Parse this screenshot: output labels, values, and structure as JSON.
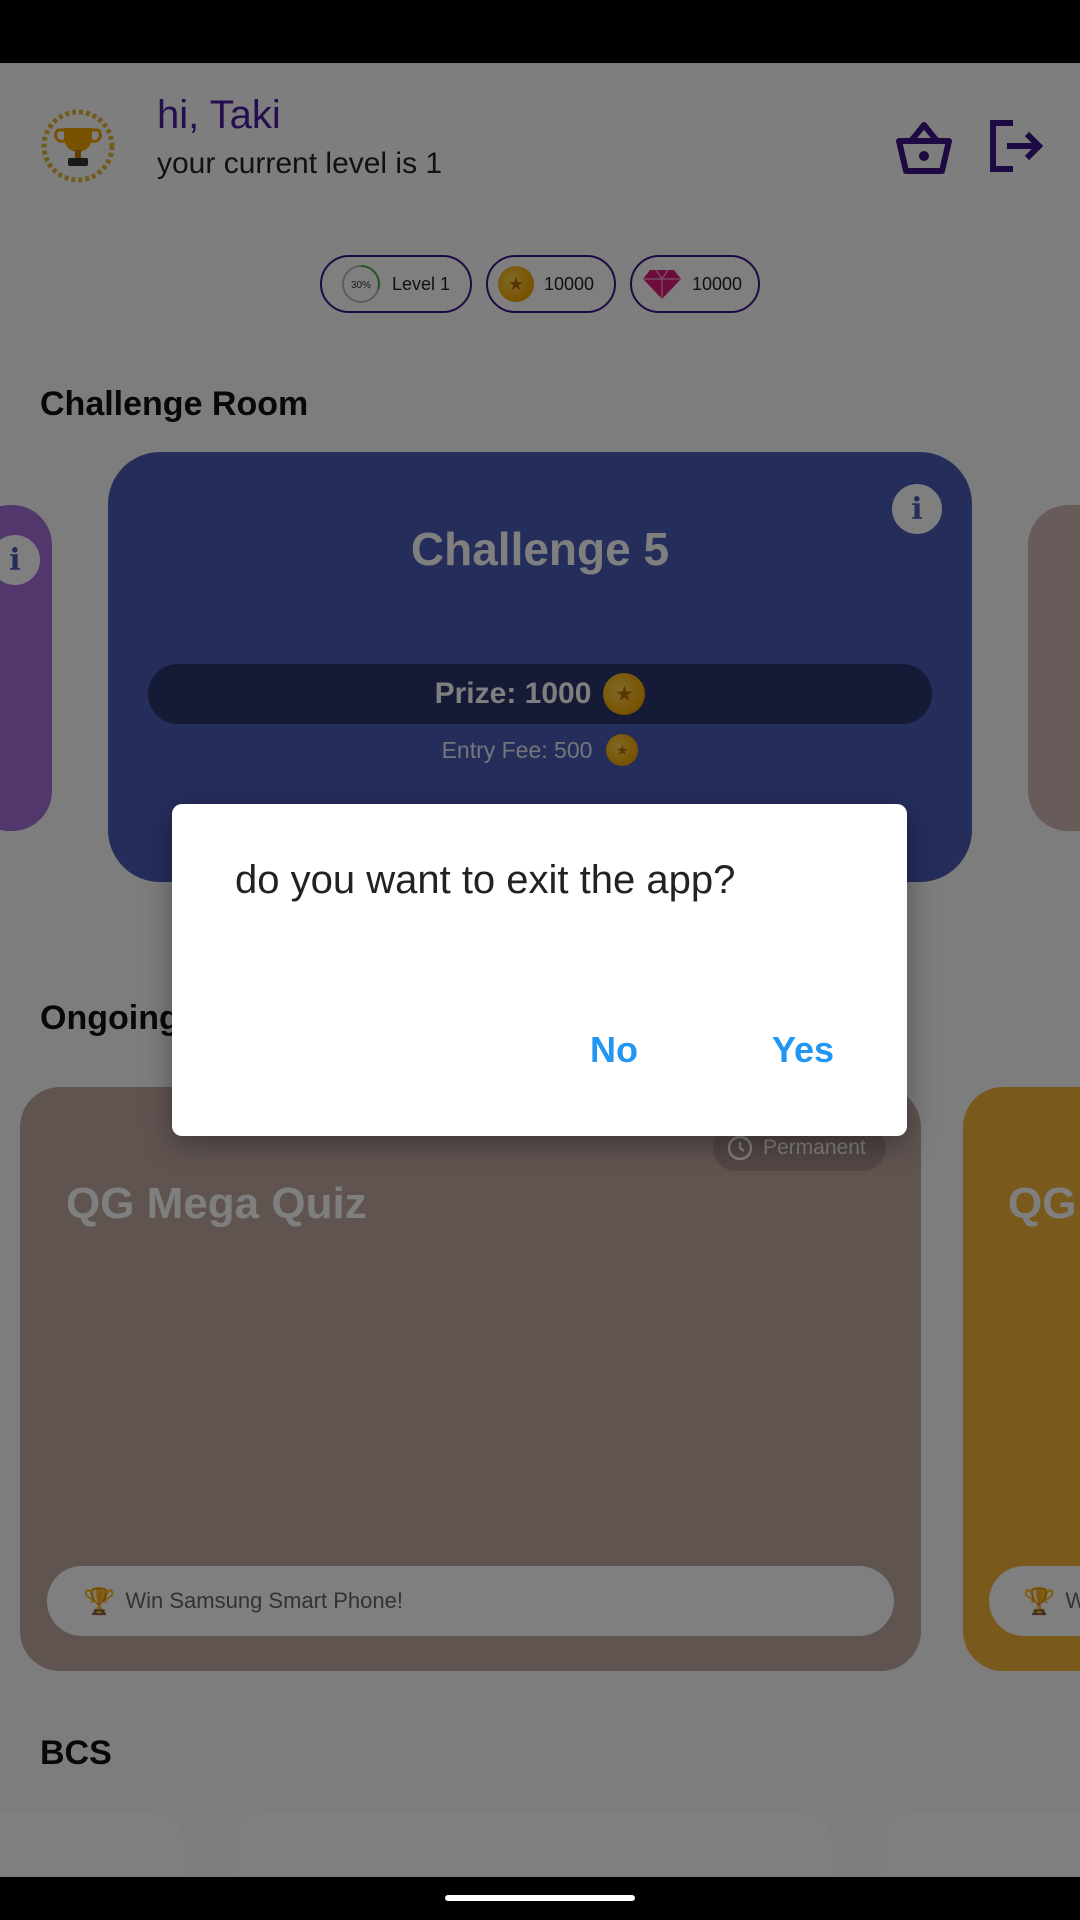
{
  "header": {
    "greeting": "hi, Taki",
    "level_text": "your current level is 1"
  },
  "stats": {
    "level_progress": "30%",
    "level_label": "Level 1",
    "coins": "10000",
    "gems": "10000"
  },
  "challenge_room": {
    "title": "Challenge Room",
    "card": {
      "name": "Challenge 5",
      "prize": "Prize: 1000",
      "entry_fee": "Entry Fee: 500"
    }
  },
  "ongoing": {
    "title": "Ongoing",
    "cards": [
      {
        "name": "QG Mega Quiz",
        "duration": "Permanent",
        "prize_note": "Win Samsung Smart Phone!"
      },
      {
        "name": "QG",
        "prize_note": "W"
      }
    ]
  },
  "bcs": {
    "title": "BCS"
  },
  "dialog": {
    "message": "do you want to exit the app?",
    "no_label": "No",
    "yes_label": "Yes"
  },
  "colors": {
    "accent_purple": "#3d1485",
    "challenge_card": "#4a5bb7",
    "dialog_button": "#2196f3",
    "coin_gold": "#f0a400",
    "gem_pink": "#d81b78"
  },
  "icons": {
    "trophy": "trophy-icon",
    "basket": "basket-icon",
    "logout": "logout-icon",
    "coin": "coin-icon",
    "gem": "gem-icon",
    "info": "info-icon",
    "clock": "clock-icon"
  }
}
